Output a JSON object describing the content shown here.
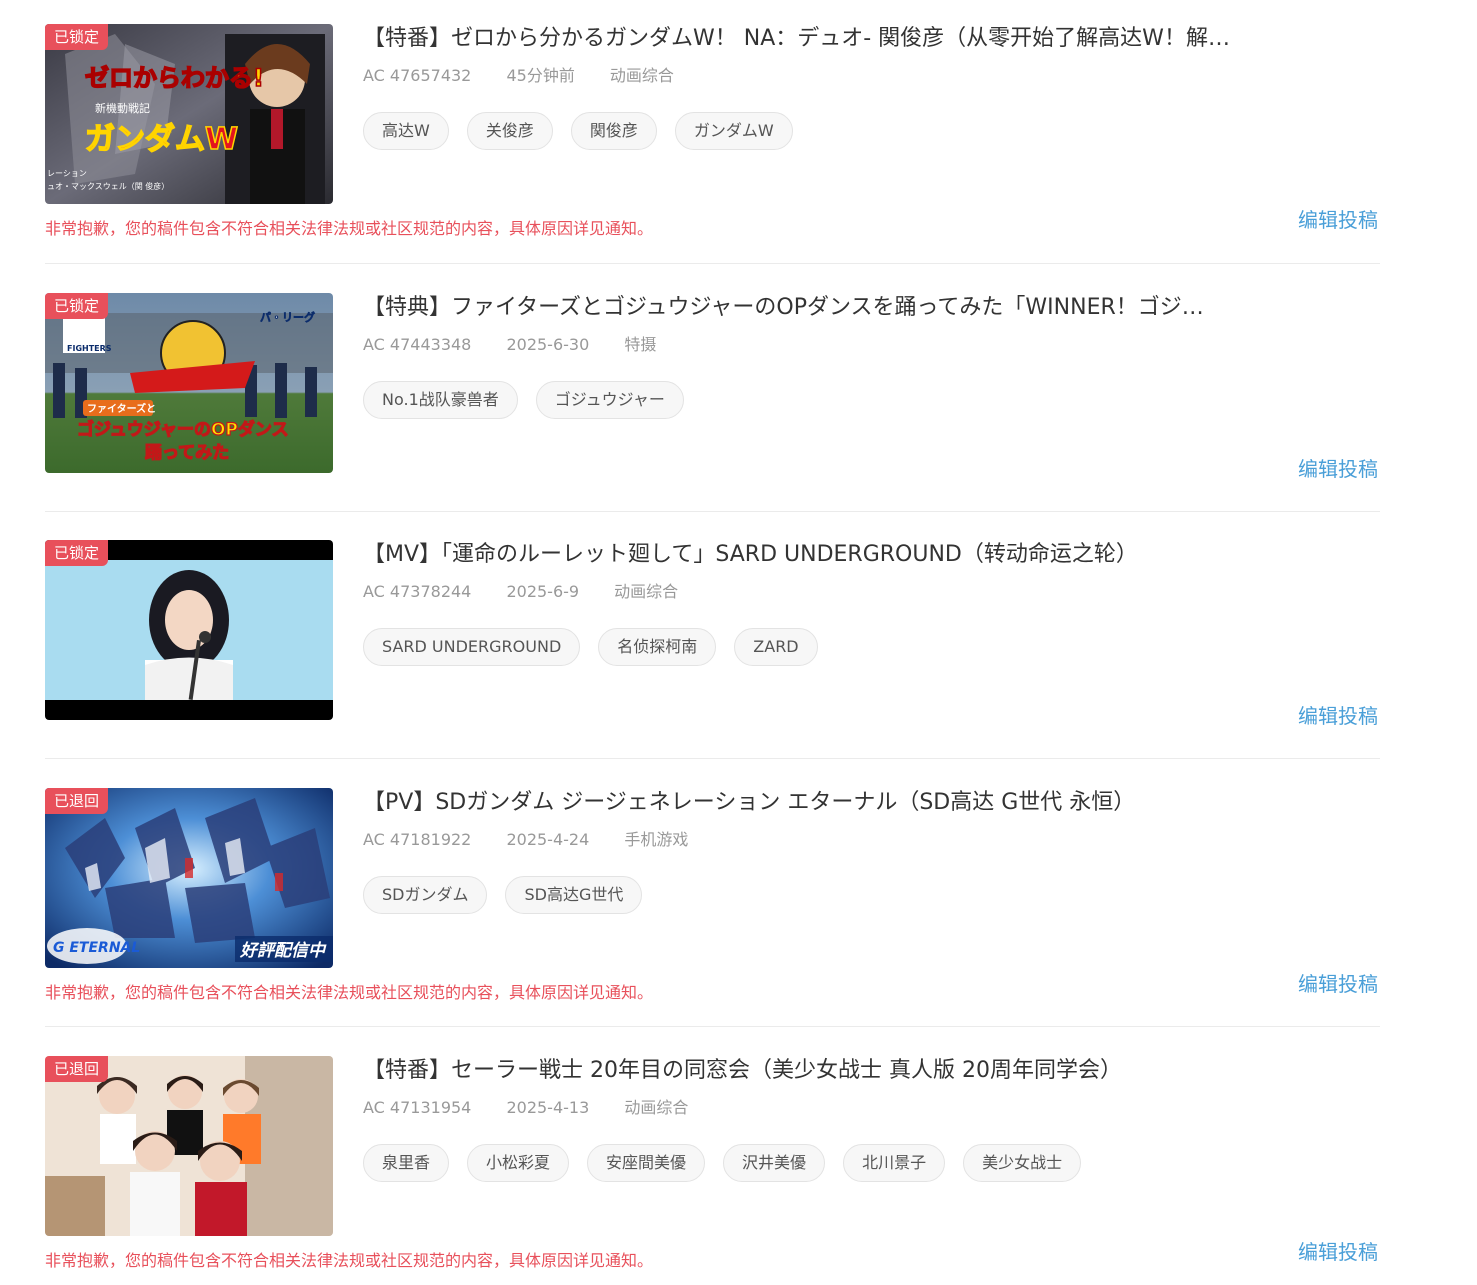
{
  "items": [
    {
      "badge": "已锁定",
      "title": "【特番】ゼロから分かるガンダムW！ NA：デュオ- 関俊彦（从零开始了解高达W！解…",
      "ac": "AC 47657432",
      "time": "45分钟前",
      "category": "动画综合",
      "tags": [
        "高达W",
        "关俊彦",
        "関俊彦",
        "ガンダムW"
      ],
      "thumb_text": [
        "ゼロからわかる!",
        "新機動戦記",
        "ガンダムW",
        "レーション",
        "ュオ・マックスウェル（関 俊彦）"
      ],
      "warning": "非常抱歉，您的稿件包含不符合相关法律法规或社区规范的内容，具体原因详见通知。",
      "edit": "编辑投稿"
    },
    {
      "badge": "已锁定",
      "title": "【特典】ファイターズとゴジュウジャーのOPダンスを踊ってみた「WINNER！ゴジ…",
      "ac": "AC 47443348",
      "time": "2025-6-30",
      "category": "特摄",
      "tags": [
        "No.1战队豪兽者",
        "ゴジュウジャー"
      ],
      "thumb_text": [
        "FIGHTERS",
        "ファイターズと",
        "ゴジュウジャーのOPダンス",
        "踊ってみた",
        "パ・リーグ"
      ],
      "warning": "",
      "edit": "编辑投稿"
    },
    {
      "badge": "已锁定",
      "title": "【MV】「運命のルーレット廻して」SARD UNDERGROUND（转动命运之轮）",
      "ac": "AC 47378244",
      "time": "2025-6-9",
      "category": "动画综合",
      "tags": [
        "SARD UNDERGROUND",
        "名侦探柯南",
        "ZARD"
      ],
      "thumb_text": [],
      "warning": "",
      "edit": "编辑投稿"
    },
    {
      "badge": "已退回",
      "title": "【PV】SDガンダム ジージェネレーション エターナル（SD高达 G世代 永恒）",
      "ac": "AC 47181922",
      "time": "2025-4-24",
      "category": "手机游戏",
      "tags": [
        "SDガンダム",
        "SD高达G世代"
      ],
      "thumb_text": [
        "G ETERNAL",
        "好評配信中"
      ],
      "warning": "非常抱歉，您的稿件包含不符合相关法律法规或社区规范的内容，具体原因详见通知。",
      "edit": "编辑投稿"
    },
    {
      "badge": "已退回",
      "title": "【特番】セーラー戦士 20年目の同窓会（美少女战士 真人版 20周年同学会）",
      "ac": "AC 47131954",
      "time": "2025-4-13",
      "category": "动画综合",
      "tags": [
        "泉里香",
        "小松彩夏",
        "安座間美優",
        "沢井美優",
        "北川景子",
        "美少女战士"
      ],
      "thumb_text": [],
      "warning": "非常抱歉，您的稿件包含不符合相关法律法规或社区规范的内容，具体原因详见通知。",
      "edit": "编辑投稿"
    }
  ],
  "colors": {
    "badge": "#e8505b",
    "warning": "#e8505b",
    "link": "#4a9fd8",
    "title": "#333333",
    "meta": "#999999"
  }
}
